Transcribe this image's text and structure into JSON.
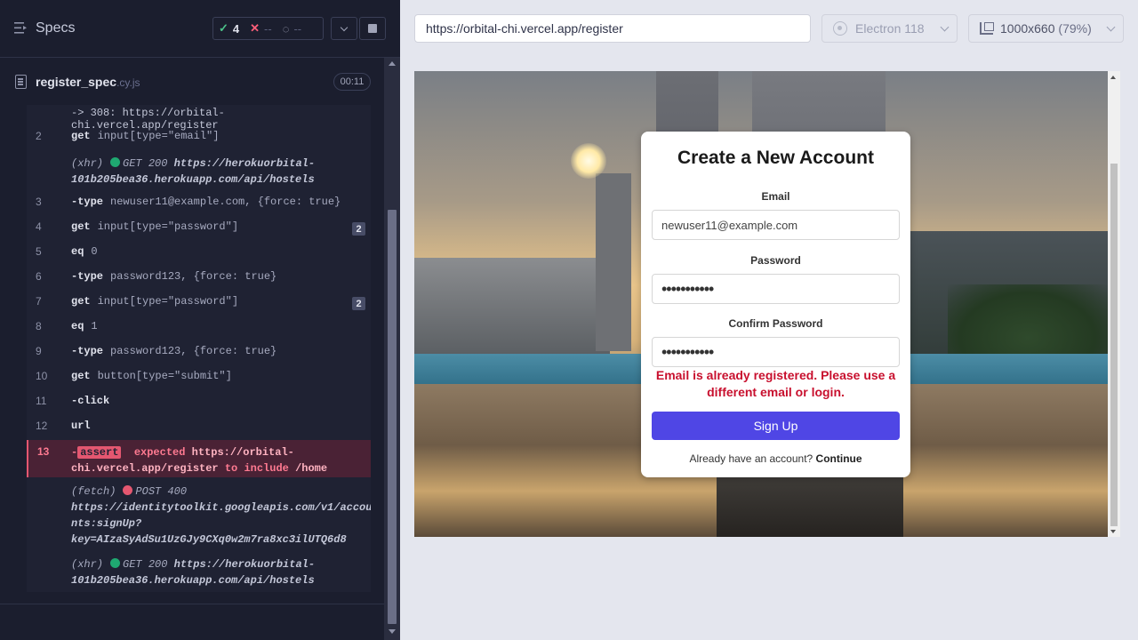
{
  "header": {
    "specs_label": "Specs",
    "stats": {
      "passed": "4",
      "failed": "--",
      "pending": "--"
    }
  },
  "spec": {
    "name": "register_spec",
    "ext": ".cy.js",
    "duration": "00:11"
  },
  "log": {
    "redirect": "-> 308: https://orbital-chi.vercel.app/register",
    "commands": [
      {
        "num": "2",
        "name": "get",
        "arg": "input[type=\"email\"]"
      },
      {
        "num": "3",
        "name": "-type",
        "arg": "newuser11@example.com, {force: true}"
      },
      {
        "num": "4",
        "name": "get",
        "arg": "input[type=\"password\"]",
        "badge": "2"
      },
      {
        "num": "5",
        "name": "eq",
        "arg": "0"
      },
      {
        "num": "6",
        "name": "-type",
        "arg": "password123, {force: true}"
      },
      {
        "num": "7",
        "name": "get",
        "arg": "input[type=\"password\"]",
        "badge": "2"
      },
      {
        "num": "8",
        "name": "eq",
        "arg": "1"
      },
      {
        "num": "9",
        "name": "-type",
        "arg": "password123, {force: true}"
      },
      {
        "num": "10",
        "name": "get",
        "arg": "button[type=\"submit\"]"
      },
      {
        "num": "11",
        "name": "-click",
        "arg": ""
      },
      {
        "num": "12",
        "name": "url",
        "arg": ""
      }
    ],
    "xhr1": {
      "kind": "(xhr)",
      "status": "GET 200",
      "url_line1": "https://herokuorbital-",
      "url_line2": "101b205bea36.herokuapp.com/api/hostels"
    },
    "failed": {
      "num": "13",
      "chip": "assert",
      "expected": "expected",
      "url_line1": "https://orbital-",
      "url_line2": "chi.vercel.app/register",
      "to_include": "to include",
      "target": "/home"
    },
    "fetch": {
      "kind": "(fetch)",
      "status": "POST 400",
      "line1": "https://identitytoolkit.googleapis.com/v1/accou",
      "line2": "nts:signUp?",
      "line3": "key=AIzaSyAdSu1UzGJy9CXq0w2m7ra8xc3ilUTQ6d8"
    },
    "xhr2": {
      "kind": "(xhr)",
      "status": "GET 200",
      "url_line1": "https://herokuorbital-",
      "url_line2": "101b205bea36.herokuapp.com/api/hostels"
    }
  },
  "browser": {
    "url": "https://orbital-chi.vercel.app/register",
    "engine": "Electron 118",
    "viewport": "1000x660",
    "zoom": "(79%)"
  },
  "form": {
    "title": "Create a New Account",
    "email_label": "Email",
    "email_value": "newuser11@example.com",
    "password_label": "Password",
    "password_value": "•••••••••••",
    "confirm_label": "Confirm Password",
    "confirm_value": "•••••••••••",
    "error": "Email is already registered. Please use a different email or login.",
    "submit": "Sign Up",
    "already_text": "Already have an account?",
    "continue_link": "Continue"
  },
  "colors": {
    "accent": "#4f46e5",
    "error": "#c8102e",
    "pass": "#4cc38a",
    "fail": "#e45770"
  }
}
